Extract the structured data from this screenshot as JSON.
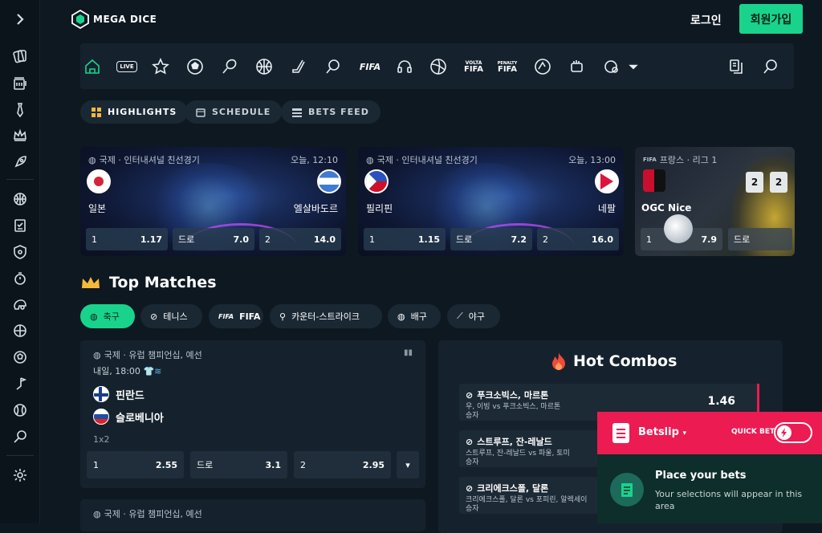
{
  "header": {
    "logo_text": "MEGA DICE",
    "login": "로그인",
    "signup": "회원가입"
  },
  "nav": {
    "live_label": "LIVE",
    "fifa_label": "FIFA",
    "volta_label": "VOLTA",
    "penalty_label": "PENALTY"
  },
  "pills": [
    {
      "label": "HIGHLIGHTS"
    },
    {
      "label": "SCHEDULE"
    },
    {
      "label": "BETS FEED"
    }
  ],
  "featured": [
    {
      "league": "국제 · 인터내셔널 친선경기",
      "time": "오늘, 12:10",
      "home": "일본",
      "away": "엘살바도르",
      "odds": [
        {
          "k": "1",
          "v": "1.17"
        },
        {
          "k": "드로",
          "v": "7.0"
        },
        {
          "k": "2",
          "v": "14.0"
        }
      ]
    },
    {
      "league": "국제 · 인터내셔널 친선경기",
      "time": "오늘, 13:00",
      "home": "필리핀",
      "away": "네팔",
      "odds": [
        {
          "k": "1",
          "v": "1.15"
        },
        {
          "k": "드로",
          "v": "7.2"
        },
        {
          "k": "2",
          "v": "16.0"
        }
      ]
    },
    {
      "league": "프랑스 · 리그 1",
      "home": "OGC Nice",
      "score": [
        "2",
        "2"
      ],
      "odds": [
        {
          "k": "1",
          "v": "7.9"
        },
        {
          "k": "드로",
          "v": ""
        }
      ]
    }
  ],
  "top_matches": {
    "title": "Top Matches"
  },
  "sport_tabs": [
    {
      "label": "축구"
    },
    {
      "label": "테니스"
    },
    {
      "label": "FIFA"
    },
    {
      "label": "카운터-스트라이크"
    },
    {
      "label": "배구"
    },
    {
      "label": "야구"
    }
  ],
  "match": {
    "league": "국제 · 유럽 챔피언십, 예선",
    "time": "내일, 18:00",
    "home": "핀란드",
    "away": "슬로베니아",
    "type": "1x2",
    "odds": [
      {
        "k": "1",
        "v": "2.55"
      },
      {
        "k": "드로",
        "v": "3.1"
      },
      {
        "k": "2",
        "v": "2.95"
      }
    ]
  },
  "match2": {
    "league": "국제 · 유럽 챔피언십, 예선"
  },
  "combos": {
    "title": "Hot Combos",
    "items": [
      {
        "title": "푸크소빅스, 마르톤",
        "line1": "우, 이빙 vs 푸크소빅스, 마르톤",
        "line2": "승자",
        "odd": "1.46"
      },
      {
        "title": "스트루프, 잔-레날드",
        "line1": "스트루프, 잔-레날드 vs 파울, 토미",
        "line2": "승자"
      },
      {
        "title": "크리에크스폴, 달론",
        "line1": "크리에크스폴, 달론 vs 포피린, 알렉세이",
        "line2": "승자"
      }
    ]
  },
  "betslip": {
    "title": "Betslip",
    "quick_bet": "QUICK BET",
    "empty_title": "Place your bets",
    "empty_text": "Your selections will appear in this area"
  },
  "colors": {
    "accent": "#19d38c",
    "betslip": "#ec1b52",
    "bg": "#0e1821"
  }
}
